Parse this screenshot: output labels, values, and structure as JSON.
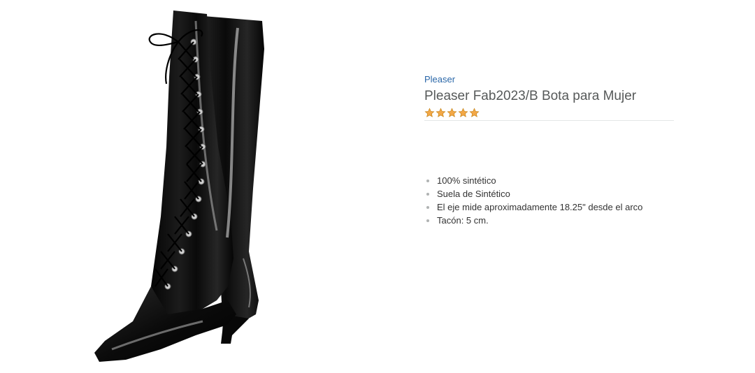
{
  "product": {
    "brand": "Pleaser",
    "title": "Pleaser Fab2023/B Bota para Mujer",
    "rating_stars": 5,
    "star_color": "#f3a847",
    "bullets": [
      "100% sintético",
      "Suela de Sintético",
      "El eje mide aproximadamente 18.25\" desde el arco",
      "Tacón: 5 cm."
    ],
    "image_icon": "black-patent-lace-up-knee-high-boot"
  }
}
